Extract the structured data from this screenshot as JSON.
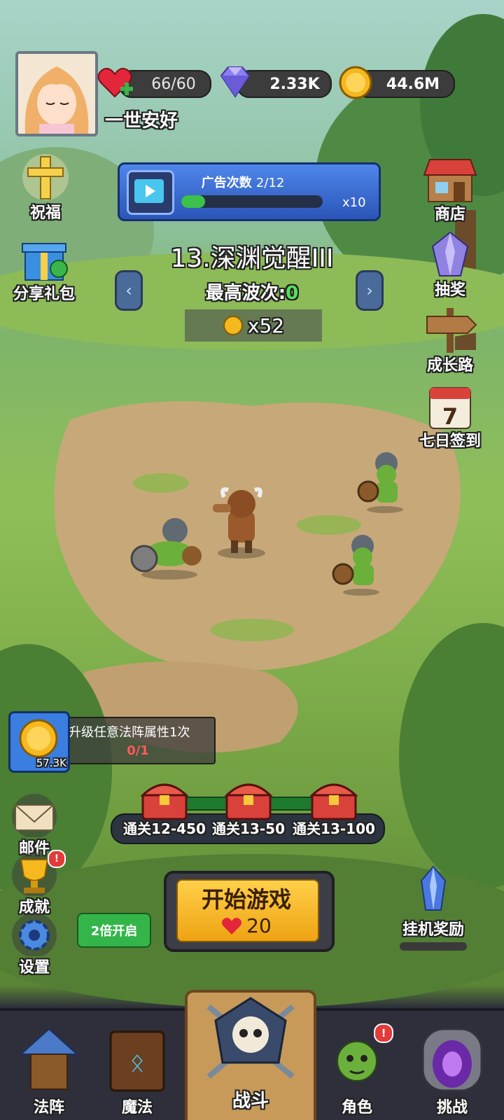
{
  "player": {
    "name": "一世安好",
    "hearts": "66/60",
    "gems": "2.33K",
    "coins": "44.6M"
  },
  "left_menu": {
    "bless": "祝福",
    "share_gift": "分享礼包"
  },
  "right_menu": {
    "shop": "商店",
    "lottery": "抽奖",
    "growth": "成长路",
    "seven_day": "七日签到",
    "seven_day_number": "7"
  },
  "ad_panel": {
    "label": "广告次数",
    "count": "2/12",
    "progress": 0.17,
    "multiplier": "x10"
  },
  "stage": {
    "title": "13.深渊觉醒III",
    "best_wave_label": "最高波次:",
    "best_wave_value": "0",
    "coin_reward": "x52"
  },
  "quest": {
    "text": "升级任意法阵属性1次",
    "progress": "0/1",
    "reward": "57.3K"
  },
  "chests": [
    {
      "label": "通关12-450"
    },
    {
      "label": "通关13-50"
    },
    {
      "label": "通关13-100"
    }
  ],
  "bottom_left": {
    "mail": "邮件",
    "achievement": "成就",
    "settings": "设置"
  },
  "double_button": "2倍开启",
  "start_button": {
    "label": "开始游戏",
    "cost": "20"
  },
  "idle_reward": "挂机奖励",
  "bottom_nav": [
    {
      "label": "法阵"
    },
    {
      "label": "魔法"
    },
    {
      "label": "战斗"
    },
    {
      "label": "角色"
    },
    {
      "label": "挑战"
    }
  ],
  "colors": {
    "accent_blue": "#3b6fd8",
    "progress_green": "#3cc24a",
    "start_gold": "#f2b629",
    "nav_bg": "#2f2f3c"
  }
}
